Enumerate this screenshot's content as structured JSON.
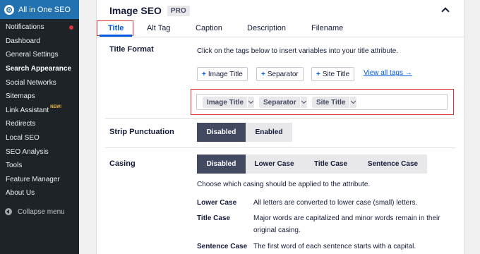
{
  "sidebar": {
    "brand": "All in One SEO",
    "items": [
      {
        "label": "Notifications",
        "dot": true
      },
      {
        "label": "Dashboard"
      },
      {
        "label": "General Settings"
      },
      {
        "label": "Search Appearance",
        "active": true
      },
      {
        "label": "Social Networks"
      },
      {
        "label": "Sitemaps"
      },
      {
        "label": "Link Assistant",
        "badge": "NEW!"
      },
      {
        "label": "Redirects"
      },
      {
        "label": "Local SEO"
      },
      {
        "label": "SEO Analysis"
      },
      {
        "label": "Tools"
      },
      {
        "label": "Feature Manager"
      },
      {
        "label": "About Us"
      }
    ],
    "collapse_label": "Collapse menu"
  },
  "panel": {
    "title": "Image SEO",
    "badge": "PRO",
    "tabs": [
      "Title",
      "Alt Tag",
      "Caption",
      "Description",
      "Filename"
    ],
    "title_format": {
      "label": "Title Format",
      "hint": "Click on the tags below to insert variables into your title attribute.",
      "tag_buttons": [
        "Image Title",
        "Separator",
        "Site Title"
      ],
      "view_all": "View all tags →",
      "chips": [
        "Image Title",
        "Separator",
        "Site Title"
      ]
    },
    "strip_punctuation": {
      "label": "Strip Punctuation",
      "options": [
        "Disabled",
        "Enabled"
      ],
      "selected": "Disabled"
    },
    "casing": {
      "label": "Casing",
      "options": [
        "Disabled",
        "Lower Case",
        "Title Case",
        "Sentence Case"
      ],
      "selected": "Disabled",
      "hint": "Choose which casing should be applied to the attribute.",
      "definitions": [
        {
          "term": "Lower Case",
          "desc": "All letters are converted to lower case (small) letters."
        },
        {
          "term": "Title Case",
          "desc": "Major words are capitalized and minor words remain in their original casing."
        },
        {
          "term": "Sentence Case",
          "desc": "The first word of each sentence starts with a capital."
        }
      ]
    }
  },
  "colors": {
    "sidebar_bg": "#1d2327",
    "sidebar_active_bg": "#2271b1",
    "accent": "#005ae0",
    "highlight_outline": "#d63638",
    "selected_segment": "#434960"
  }
}
